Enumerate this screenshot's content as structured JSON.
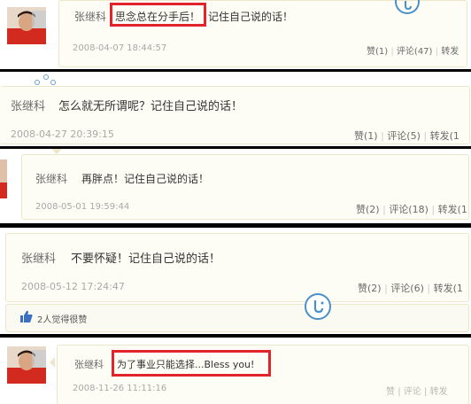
{
  "posts": [
    {
      "author": "张继科",
      "text_highlight": "思念总在分手后！",
      "text_rest": "记住自己说的话！",
      "date": "2008-04-07 18:44:57",
      "like": "赞(1)",
      "comment": "评论(47)",
      "forward": "转发"
    },
    {
      "author": "张继科",
      "text": "怎么就无所谓呢？记住自己说的话！",
      "date": "2008-04-27 20:39:15",
      "like": "赞(1)",
      "comment": "评论(5)",
      "forward": "转发(1"
    },
    {
      "author": "张继科",
      "text": "再胖点！记住自己说的话！",
      "date": "2008-05-01 19:59:44",
      "like": "赞(2)",
      "comment": "评论(18)",
      "forward": "转发(1"
    },
    {
      "author": "张继科",
      "text": "不要怀疑！记住自己说的话！",
      "date": "2008-05-12 17:24:47",
      "like": "赞(2)",
      "comment": "评论(6)",
      "forward": "转发(1"
    },
    {
      "author": "张继科",
      "text_highlight": "为了事业只能选择...Bless you!",
      "date": "2008-11-26 11:11:16",
      "like": "赞",
      "comment": "评论",
      "forward": "转发"
    }
  ],
  "likes_summary": "2人觉得很赞",
  "colors": {
    "highlight": "#e3232c",
    "author": "#6a6a6a",
    "date": "#a8a8a8",
    "card_bg": "#fefdf5",
    "card_border": "#eee6c8",
    "like_blue": "#3b6fc4",
    "logo_blue": "#4a90c8"
  },
  "icons": [
    "thumbs-up-icon",
    "weibo-logo-icon",
    "avatar"
  ]
}
